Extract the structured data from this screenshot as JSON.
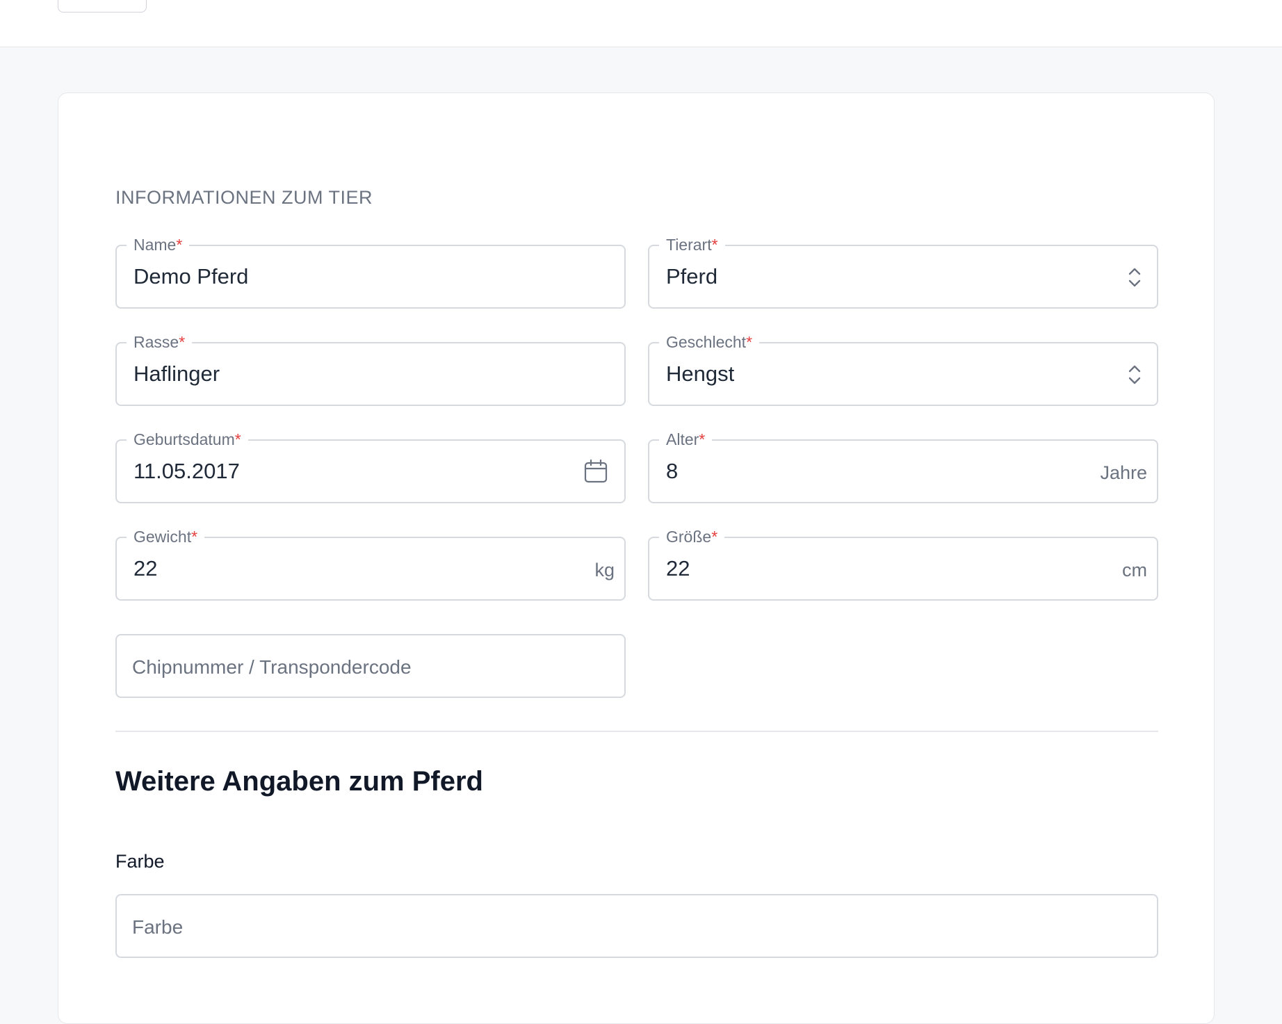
{
  "section_title": "INFORMATIONEN ZUM TIER",
  "fields": {
    "name": {
      "label": "Name",
      "required": "*",
      "value": "Demo Pferd"
    },
    "tierart": {
      "label": "Tierart",
      "required": "*",
      "value": "Pferd"
    },
    "rasse": {
      "label": "Rasse",
      "required": "*",
      "value": "Haflinger"
    },
    "geschlecht": {
      "label": "Geschlecht",
      "required": "*",
      "value": "Hengst"
    },
    "geburtsdatum": {
      "label": "Geburtsdatum",
      "required": "*",
      "value": "11.05.2017"
    },
    "alter": {
      "label": "Alter",
      "required": "*",
      "value": "8",
      "suffix": "Jahre"
    },
    "gewicht": {
      "label": "Gewicht",
      "required": "*",
      "value": "22",
      "suffix": "kg"
    },
    "groesse": {
      "label": "Größe",
      "required": "*",
      "value": "22",
      "suffix": "cm"
    },
    "chipnummer": {
      "placeholder": "Chipnummer / Transpondercode"
    }
  },
  "more_section": {
    "heading": "Weitere Angaben zum Pferd",
    "farbe_label": "Farbe",
    "farbe_placeholder": "Farbe"
  },
  "colors": {
    "required": "#e53e3e",
    "border": "#d6d9de",
    "label": "#6b7280",
    "text": "#1f2937",
    "background": "#f7f8fa"
  },
  "icons": {
    "select": "chevron-up-down-icon",
    "date": "calendar-icon"
  }
}
